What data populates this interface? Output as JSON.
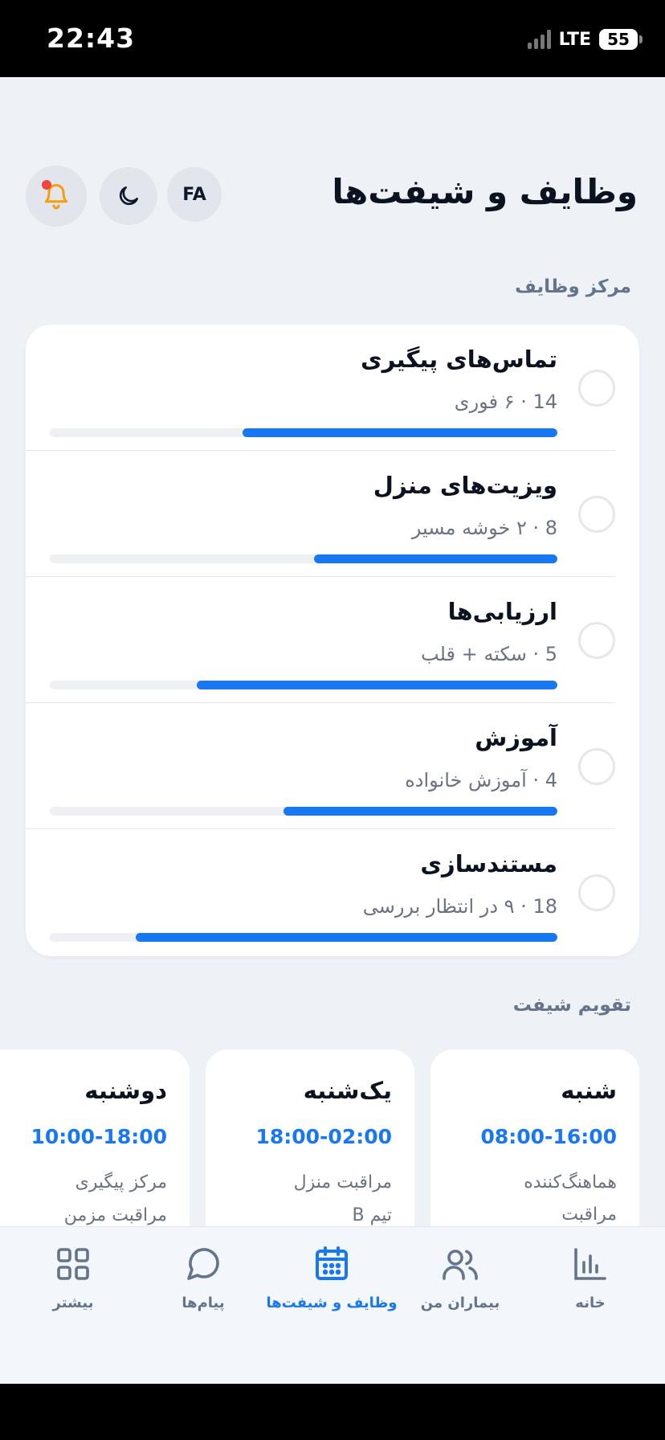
{
  "status": {
    "time": "22:43",
    "network": "LTE",
    "battery": "55"
  },
  "header": {
    "title": "وظایف و شیفت‌ها",
    "lang_label": "FA"
  },
  "sections": {
    "tasks": "مرکز وظایف",
    "shifts": "تقویم شیفت"
  },
  "tasks": [
    {
      "title": "تماس‌های پیگیری",
      "subtitle": "14 · ۶ فوری",
      "progress": 0.62
    },
    {
      "title": "ویزیت‌های منزل",
      "subtitle": "8 · ۲ خوشه مسیر",
      "progress": 0.48
    },
    {
      "title": "ارزیابی‌ها",
      "subtitle": "5 · سکته + قلب",
      "progress": 0.71
    },
    {
      "title": "آموزش",
      "subtitle": "4 · آموزش خانواده",
      "progress": 0.54
    },
    {
      "title": "مستندسازی",
      "subtitle": "18 · ۹ در انتظار بررسی",
      "progress": 0.83
    }
  ],
  "shifts": [
    {
      "day": "شنبه",
      "time": "08:00-16:00",
      "role": "هماهنگ‌کننده مراقبت",
      "extra": ""
    },
    {
      "day": "یک‌شنبه",
      "time": "18:00-02:00",
      "role": "مراقبت منزل",
      "extra": "تیم B"
    },
    {
      "day": "دوشنبه",
      "time": "10:00-18:00",
      "role": "مرکز پیگیری",
      "extra": "مراقبت مزمن"
    }
  ],
  "tabs": [
    {
      "label": "خانه",
      "icon": "chart-icon",
      "active": false
    },
    {
      "label": "بیماران من",
      "icon": "users-icon",
      "active": false
    },
    {
      "label": "وظایف و شیفت‌ها",
      "icon": "calendar-icon",
      "active": true
    },
    {
      "label": "پیام‌ها",
      "icon": "chat-icon",
      "active": false
    },
    {
      "label": "بیشتر",
      "icon": "grid-icon",
      "active": false
    }
  ],
  "colors": {
    "accent": "#1877f2",
    "bell": "#f59e0b",
    "notification_dot": "#ef4444"
  }
}
